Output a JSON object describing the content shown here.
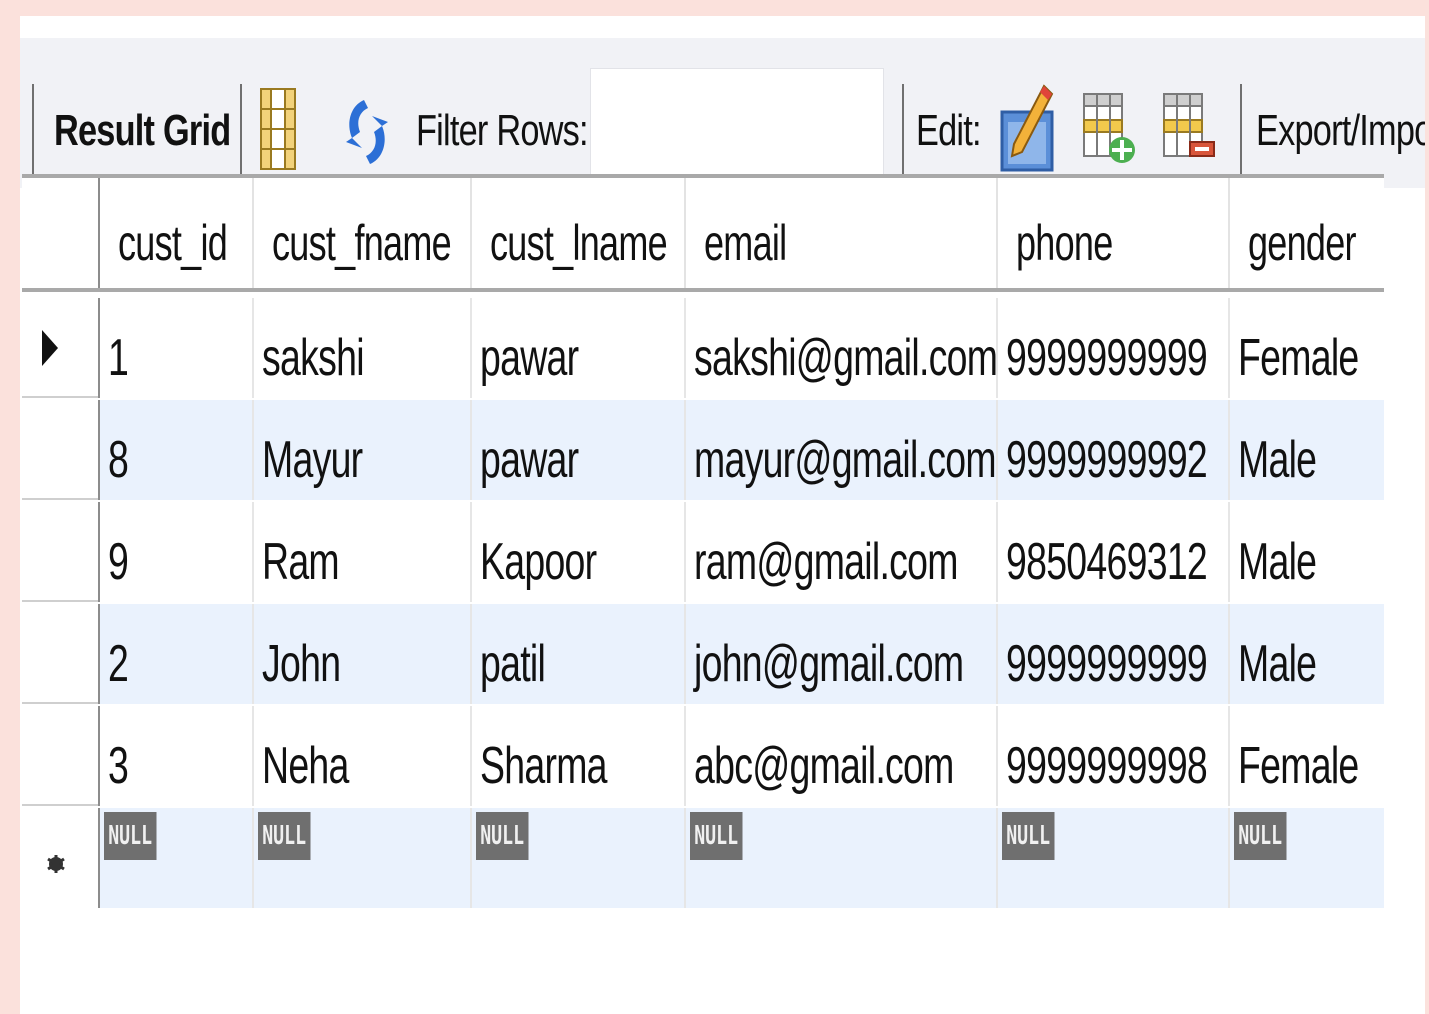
{
  "toolbar": {
    "result_grid_label": "Result Grid",
    "filter_rows_label": "Filter Rows:",
    "filter_value": "",
    "edit_label": "Edit:",
    "export_label": "Export/Impo"
  },
  "columns": [
    "cust_id",
    "cust_fname",
    "cust_lname",
    "email",
    "phone",
    "gender"
  ],
  "rows": [
    [
      "1",
      "sakshi",
      "pawar",
      "sakshi@gmail.com",
      "9999999999",
      "Female"
    ],
    [
      "8",
      "Mayur",
      "pawar",
      "mayur@gmail.com",
      "9999999992",
      "Male"
    ],
    [
      "9",
      "Ram",
      "Kapoor",
      "ram@gmail.com",
      "9850469312",
      "Male"
    ],
    [
      "2",
      "John",
      "patil",
      "john@gmail.com",
      "9999999999",
      "Male"
    ],
    [
      "3",
      "Neha",
      "Sharma",
      "abc@gmail.com",
      "9999999998",
      "Female"
    ]
  ],
  "new_row": [
    "NULL",
    "NULL",
    "NULL",
    "NULL",
    "NULL",
    "NULL"
  ],
  "colors": {
    "alt_row": "#eaf2fd",
    "null_badge": "#6f6f6f",
    "page_background": "#fbe1dc"
  }
}
